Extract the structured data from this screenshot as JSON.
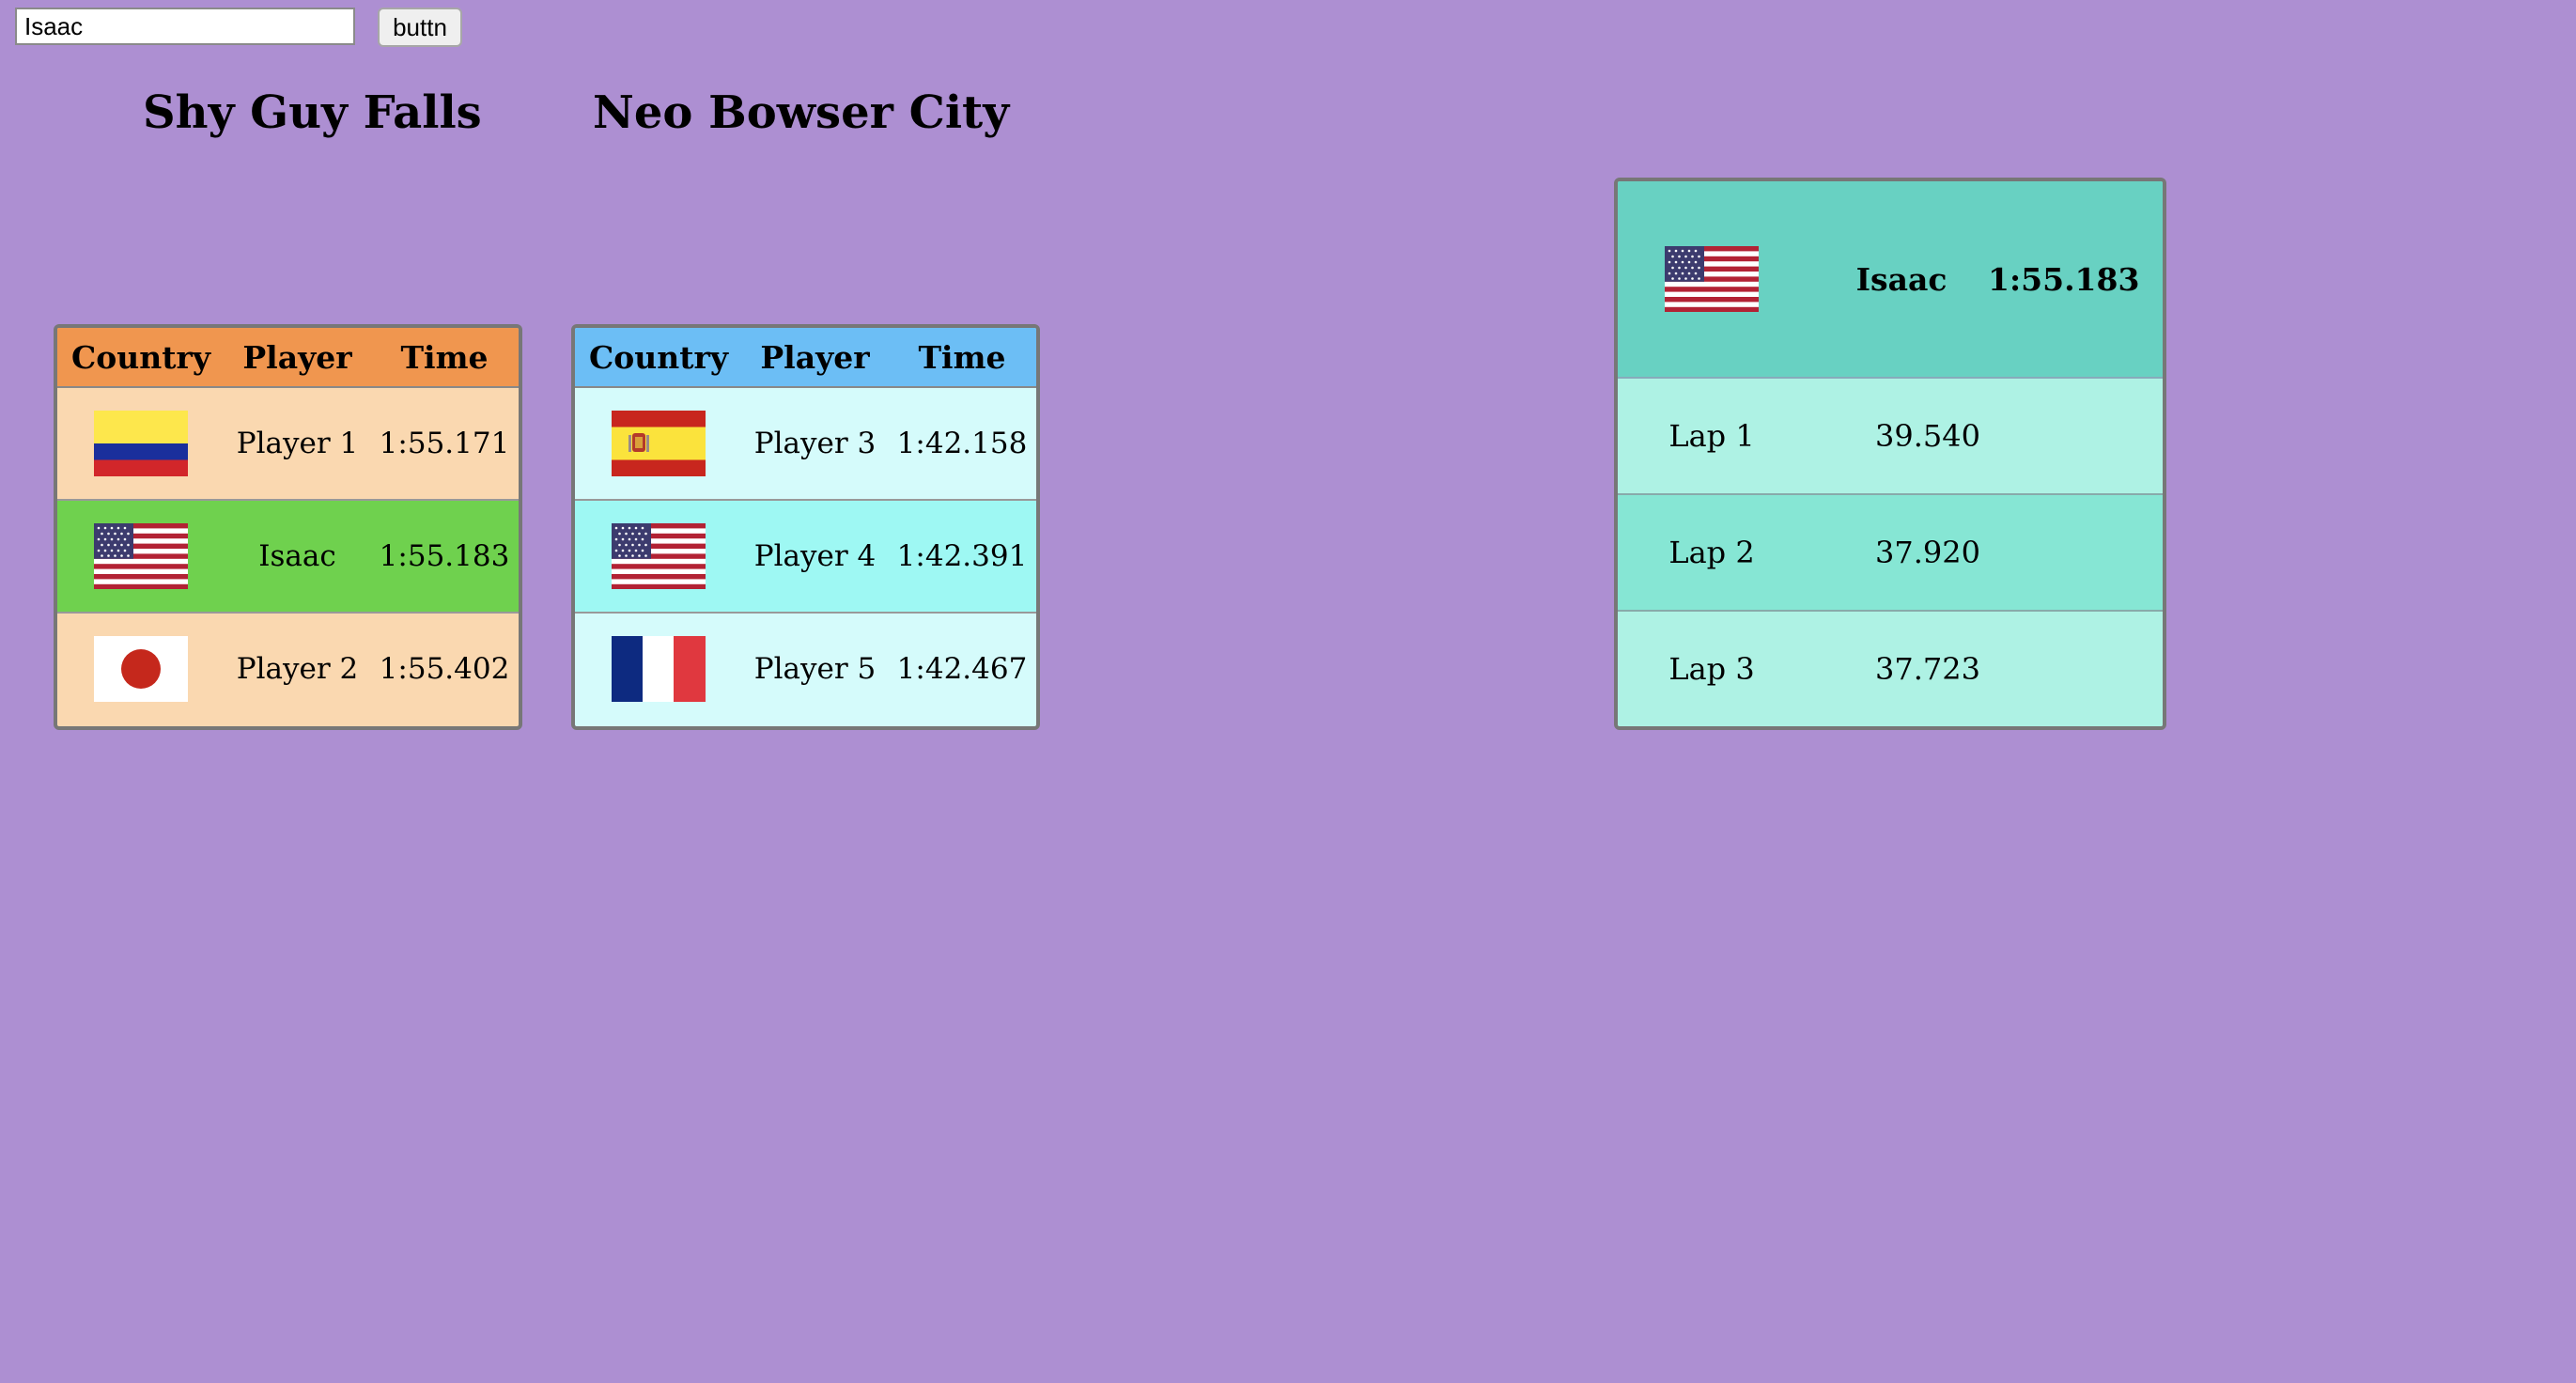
{
  "search": {
    "value": "Isaac"
  },
  "go_button": {
    "label": "buttn"
  },
  "tracks": [
    {
      "title": "Shy Guy Falls",
      "header_color": "#f0964f",
      "row_color": "#fad8b0",
      "highlight_color": "#6fd14e",
      "highlight_text_color": "#f5e04a",
      "columns": [
        "Country",
        "Player",
        "Time"
      ],
      "rows": [
        {
          "flag": "colombia-flag",
          "player": "Player 1",
          "time": "1:55.171",
          "highlight": false
        },
        {
          "flag": "usa-flag",
          "player": "Isaac",
          "time": "1:55.183",
          "highlight": true
        },
        {
          "flag": "japan-flag",
          "player": "Player 2",
          "time": "1:55.402",
          "highlight": false
        }
      ]
    },
    {
      "title": "Neo Bowser City",
      "header_color": "#6cbef5",
      "row_color": "#d5fbfb",
      "alt_row_color": "#9ef8f3",
      "columns": [
        "Country",
        "Player",
        "Time"
      ],
      "rows": [
        {
          "flag": "spain-flag",
          "player": "Player 3",
          "time": "1:42.158",
          "highlight": false
        },
        {
          "flag": "usa-flag",
          "player": "Player 4",
          "time": "1:42.391",
          "highlight": false
        },
        {
          "flag": "france-flag",
          "player": "Player 5",
          "time": "1:42.467",
          "highlight": false
        }
      ]
    }
  ],
  "detail": {
    "flag": "usa-flag",
    "player": "Isaac",
    "time": "1:55.183",
    "header_color": "#68d1c2",
    "laps": [
      {
        "label": "Lap 1",
        "time": "39.540"
      },
      {
        "label": "Lap 2",
        "time": "37.920"
      },
      {
        "label": "Lap 3",
        "time": "37.723"
      }
    ]
  }
}
